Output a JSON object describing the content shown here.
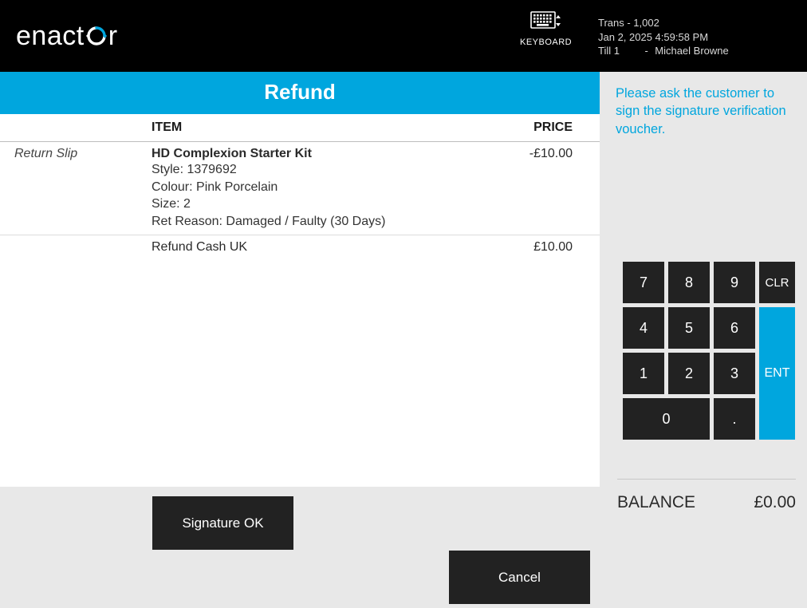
{
  "brand": "enactor",
  "keyboard_label": "KEYBOARD",
  "transaction": {
    "trans": "Trans - 1,002",
    "datetime": "Jan 2, 2025 4:59:58 PM",
    "till": "Till 1",
    "sep": "-",
    "user": "Michael Browne"
  },
  "page_title": "Refund",
  "columns": {
    "item": "ITEM",
    "price": "PRICE"
  },
  "items": [
    {
      "slip": "Return Slip",
      "name": "HD Complexion Starter Kit",
      "style": "Style: 1379692",
      "colour": "Colour: Pink Porcelain",
      "size": "Size: 2",
      "reason": "Ret Reason: Damaged / Faulty (30 Days)",
      "price": "-£10.00"
    }
  ],
  "tender": {
    "label": "Refund Cash UK",
    "amount": "£10.00"
  },
  "buttons": {
    "signature": "Signature OK",
    "cancel": "Cancel"
  },
  "prompt": "Please ask the customer to sign the signature verification voucher.",
  "keypad": {
    "k7": "7",
    "k8": "8",
    "k9": "9",
    "clr": "CLR",
    "k4": "4",
    "k5": "5",
    "k6": "6",
    "ent": "ENT",
    "k1": "1",
    "k2": "2",
    "k3": "3",
    "k0": "0",
    "dot": "."
  },
  "balance": {
    "label": "BALANCE",
    "value": "£0.00"
  }
}
